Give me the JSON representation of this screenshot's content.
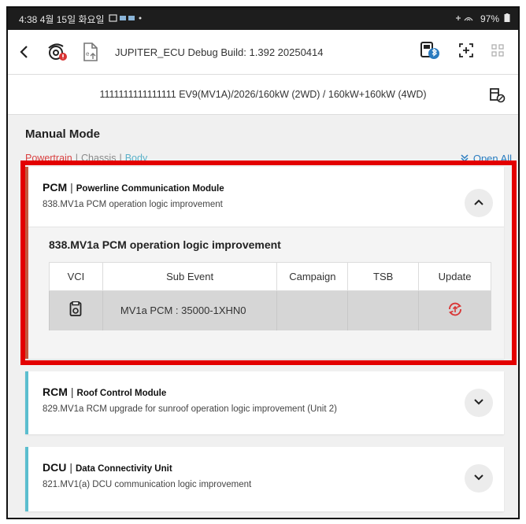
{
  "status_bar": {
    "time_date": "4:38 4월 15일 화요일",
    "battery": "97%"
  },
  "toolbar": {
    "back_glyph": "<",
    "title": "JUPITER_ECU Debug Build: 1.392 20250414",
    "icons": [
      "settings-badge-icon",
      "file-upload-icon",
      "bluetooth-vci-icon",
      "add-window-icon",
      "grid-icon"
    ]
  },
  "vehicle": {
    "info": "1111111111111111  EV9(MV1A)/2026/160kW (2WD) / 160kW+160kW (4WD)"
  },
  "main": {
    "mode_title": "Manual Mode",
    "categories": [
      "Powertrain",
      "Chassis",
      "Body"
    ],
    "separator": "|",
    "open_all": "Open All"
  },
  "cards": [
    {
      "code": "PCM",
      "full_name": "Powerline Communication Module",
      "description": "838.MV1a PCM operation logic improvement",
      "expanded": true,
      "accent": "#c4583c"
    },
    {
      "code": "RCM",
      "full_name": "Roof Control Module",
      "description": "829.MV1a RCM upgrade for sunroof operation logic improvement (Unit 2)",
      "expanded": false,
      "accent": "#5bbecf"
    },
    {
      "code": "DCU",
      "full_name": "Data Connectivity Unit",
      "description": "821.MV1(a) DCU communication logic improvement",
      "expanded": false,
      "accent": "#5bbecf"
    }
  ],
  "pcm_detail": {
    "title": "838.MV1a PCM operation logic improvement",
    "columns": [
      "VCI",
      "Sub Event",
      "Campaign",
      "TSB",
      "Update"
    ],
    "row": {
      "vci_icon": "vci-device-icon",
      "sub_event": "MV1a PCM : 35000-1XHN0",
      "campaign": "",
      "tsb": "",
      "update_icon": "update-refresh-icon"
    }
  },
  "colors": {
    "highlight": "#e30000",
    "powertrain": "#d94040",
    "chassis": "#8a8a8a",
    "body": "#5bb0c8",
    "open_all": "#2a7bbf",
    "update_icon": "#d93535"
  }
}
